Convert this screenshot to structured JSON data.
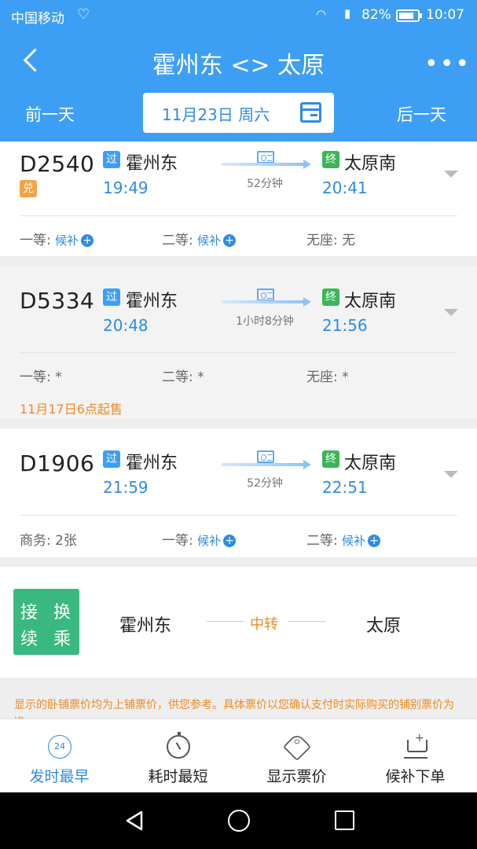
{
  "status": {
    "carrier": "中国移动",
    "network": "4G",
    "battery": "82%",
    "time": "10:07"
  },
  "header": {
    "title": "霍州东 <> 太原",
    "prev_day": "前一天",
    "next_day": "后一天",
    "date": "11月23日 周六"
  },
  "trains": [
    {
      "code": "D2540",
      "extra_badge": "兑",
      "from_badge": "过",
      "from": "霍州东",
      "depart": "19:49",
      "duration": "52分钟",
      "to_badge": "终",
      "to": "太原南",
      "arrive": "20:41",
      "seats": [
        {
          "label": "一等:",
          "value": "候补",
          "plus": true
        },
        {
          "label": "二等:",
          "value": "候补",
          "plus": true
        },
        {
          "label": "无座:",
          "value": "无",
          "plus": false
        }
      ]
    },
    {
      "code": "D5334",
      "from_badge": "过",
      "from": "霍州东",
      "depart": "20:48",
      "duration": "1小时8分钟",
      "to_badge": "终",
      "to": "太原南",
      "arrive": "21:56",
      "seats": [
        {
          "label": "一等:",
          "value": "*"
        },
        {
          "label": "二等:",
          "value": "*"
        },
        {
          "label": "无座:",
          "value": "*"
        }
      ],
      "sale_note": "11月17日6点起售"
    },
    {
      "code": "D1906",
      "from_badge": "过",
      "from": "霍州东",
      "depart": "21:59",
      "duration": "52分钟",
      "to_badge": "终",
      "to": "太原南",
      "arrive": "22:51",
      "seats": [
        {
          "label": "商务:",
          "value": "2张",
          "plus": false
        },
        {
          "label": "一等:",
          "value": "候补",
          "plus": true
        },
        {
          "label": "二等:",
          "value": "候补",
          "plus": true
        }
      ]
    }
  ],
  "transfer": {
    "badge": [
      "接",
      "换",
      "续",
      "乘"
    ],
    "from": "霍州东",
    "middle": "中转",
    "to": "太原"
  },
  "notice": "显示的卧铺票价均为上铺票价，供您参考。具体票价以您确认支付时实际购买的铺别票价为准。",
  "tabs": [
    {
      "label": "发时最早",
      "icon": "clock-24-icon",
      "icon_text": "24"
    },
    {
      "label": "耗时最短",
      "icon": "timer-icon"
    },
    {
      "label": "显示票价",
      "icon": "price-tag-icon"
    },
    {
      "label": "候补下单",
      "icon": "cart-plus-icon"
    }
  ],
  "colors": {
    "primary": "#3d9ff3",
    "accent_orange": "#ef8a21",
    "green": "#3cb559"
  }
}
